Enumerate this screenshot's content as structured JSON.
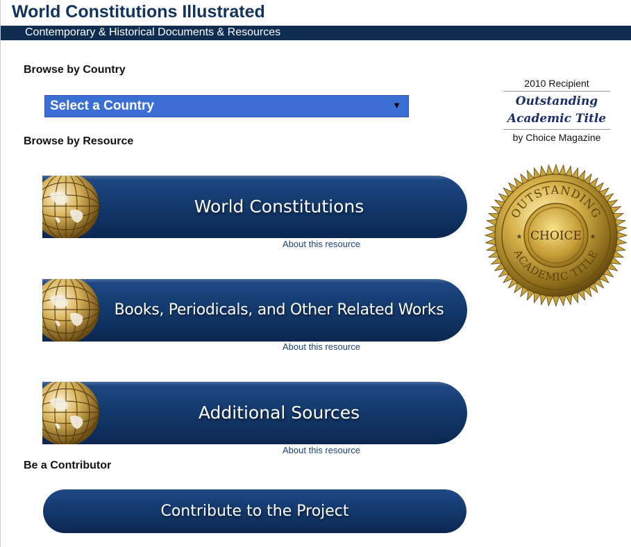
{
  "header": {
    "title": "World Constitutions Illustrated",
    "subtitle": "Contemporary & Historical Documents & Resources"
  },
  "browse_country": {
    "heading": "Browse by Country",
    "select_value": "Select a Country",
    "select_arrow": "▼"
  },
  "browse_resource": {
    "heading": "Browse by Resource",
    "resources": [
      {
        "label": "World Constitutions",
        "about": "About this resource",
        "icon": "globe-icon"
      },
      {
        "label": "Books, Periodicals, and Other Related Works",
        "about": "About this resource",
        "icon": "globe-icon"
      },
      {
        "label": "Additional Sources",
        "about": "About this resource",
        "icon": "globe-icon"
      }
    ]
  },
  "contributor": {
    "heading": "Be a Contributor",
    "button_label": "Contribute to the Project"
  },
  "award": {
    "year_line": "2010 Recipient",
    "title_line1": "Outstanding",
    "title_line2": "Academic Title",
    "by_line": "by Choice Magazine",
    "seal_top_text": "OUTSTANDING",
    "seal_center_text": "CHOICE",
    "seal_bottom_text": "ACADEMIC TITLE"
  },
  "colors": {
    "brand_navy": "#0e2d50",
    "title_navy": "#12335c",
    "select_blue": "#3b6fd6",
    "banner_gradient_top": "#1f4a86",
    "banner_gradient_bottom": "#0b2751",
    "seal_gold": "#c9a43a"
  }
}
